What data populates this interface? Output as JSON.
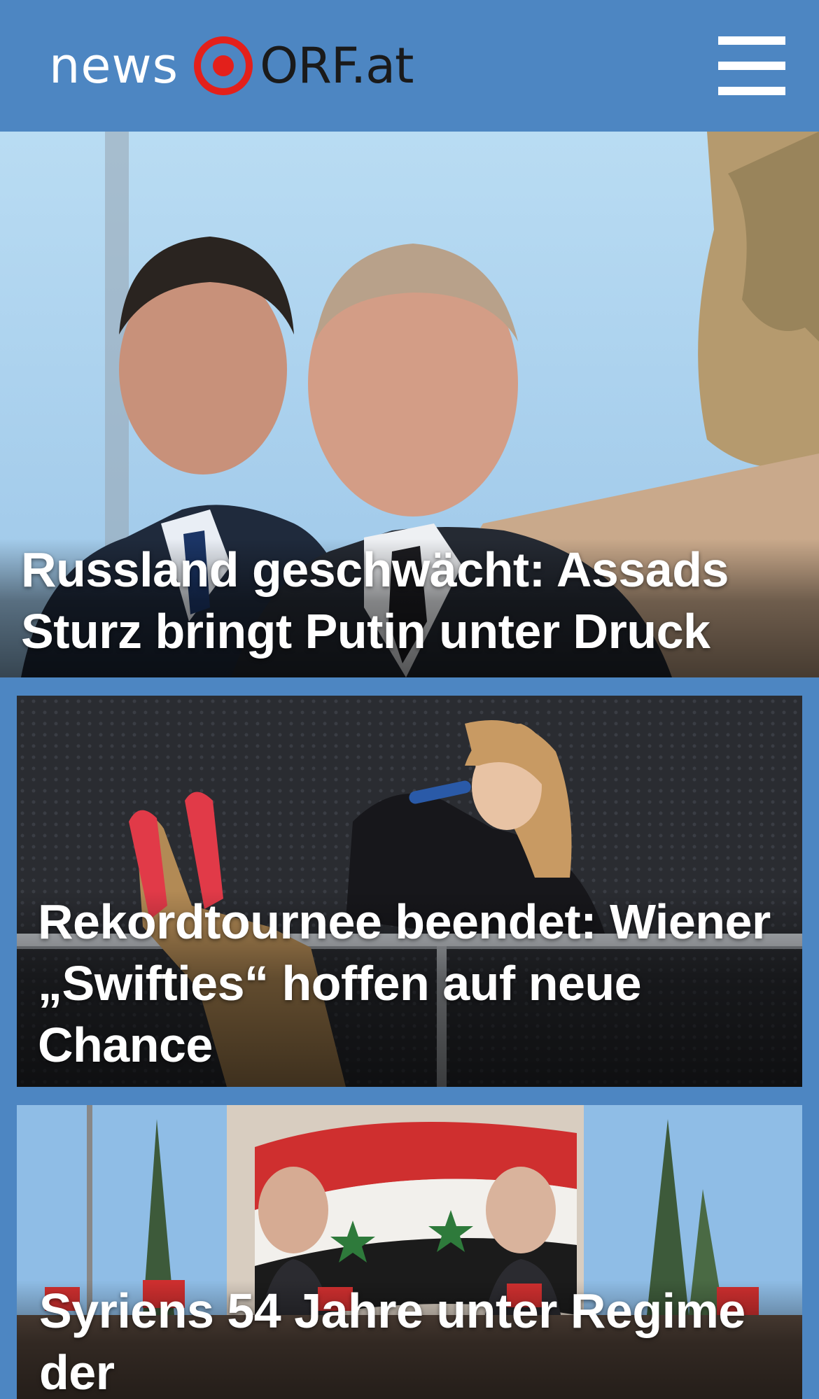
{
  "header": {
    "logo_news": "news",
    "logo_orf": "ORF.at",
    "menu_label": "Menü"
  },
  "colors": {
    "header_bg": "#4d86c2",
    "logo_red": "#e3201b",
    "logo_dark": "#1a1a1a"
  },
  "stories": [
    {
      "headline": "Russland geschwächt: Assads Sturz bringt Putin unter Druck",
      "image_alt": "Assad und Putin"
    },
    {
      "headline": "Rekordtournee beendet: Wiener „Swifties“ hoffen auf neue Chance",
      "image_alt": "Taylor Swift bei einem Konzert"
    },
    {
      "headline": "Syriens 54 Jahre unter Regime der",
      "image_alt": "Menschenmenge mit syrischen Flaggen vor einem Plakat"
    }
  ],
  "icons": {
    "logo": "orf-eye-icon",
    "menu": "hamburger-menu-icon"
  }
}
